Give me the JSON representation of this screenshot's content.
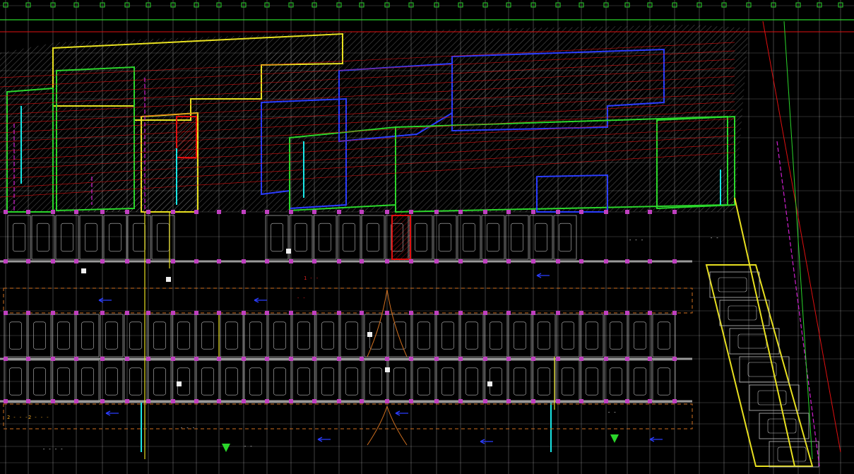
{
  "drawing": {
    "background": "#000000",
    "palette": {
      "grid": "#c8c8c8",
      "grid_dash": "#9a9a9a",
      "wall_green": "#2bd62b",
      "wall_blue": "#2a3cff",
      "red_line": "#e01010",
      "yellow": "#e8e020",
      "magenta": "#d020d0",
      "cyan": "#18e6e6",
      "orange": "#d07020",
      "stall_gray": "#bdbdbd",
      "hatch_gray": "#8a8a8a",
      "white": "#f0f0f0",
      "column_marker": "#c040c0"
    },
    "labels": [
      {
        "id": "lbl-01",
        "text": "2 - - -"
      },
      {
        "id": "lbl-02",
        "text": "2 - - -"
      },
      {
        "id": "lbl-03",
        "text": "- -"
      },
      {
        "id": "lbl-04",
        "text": "1 - -"
      },
      {
        "id": "lbl-05",
        "text": "- - -"
      },
      {
        "id": "lbl-06",
        "text": "- -"
      },
      {
        "id": "lbl-07",
        "text": "- - - -"
      },
      {
        "id": "lbl-08",
        "text": "- - -"
      },
      {
        "id": "lbl-09",
        "text": "- -"
      },
      {
        "id": "lbl-10",
        "text": "- -"
      }
    ]
  }
}
